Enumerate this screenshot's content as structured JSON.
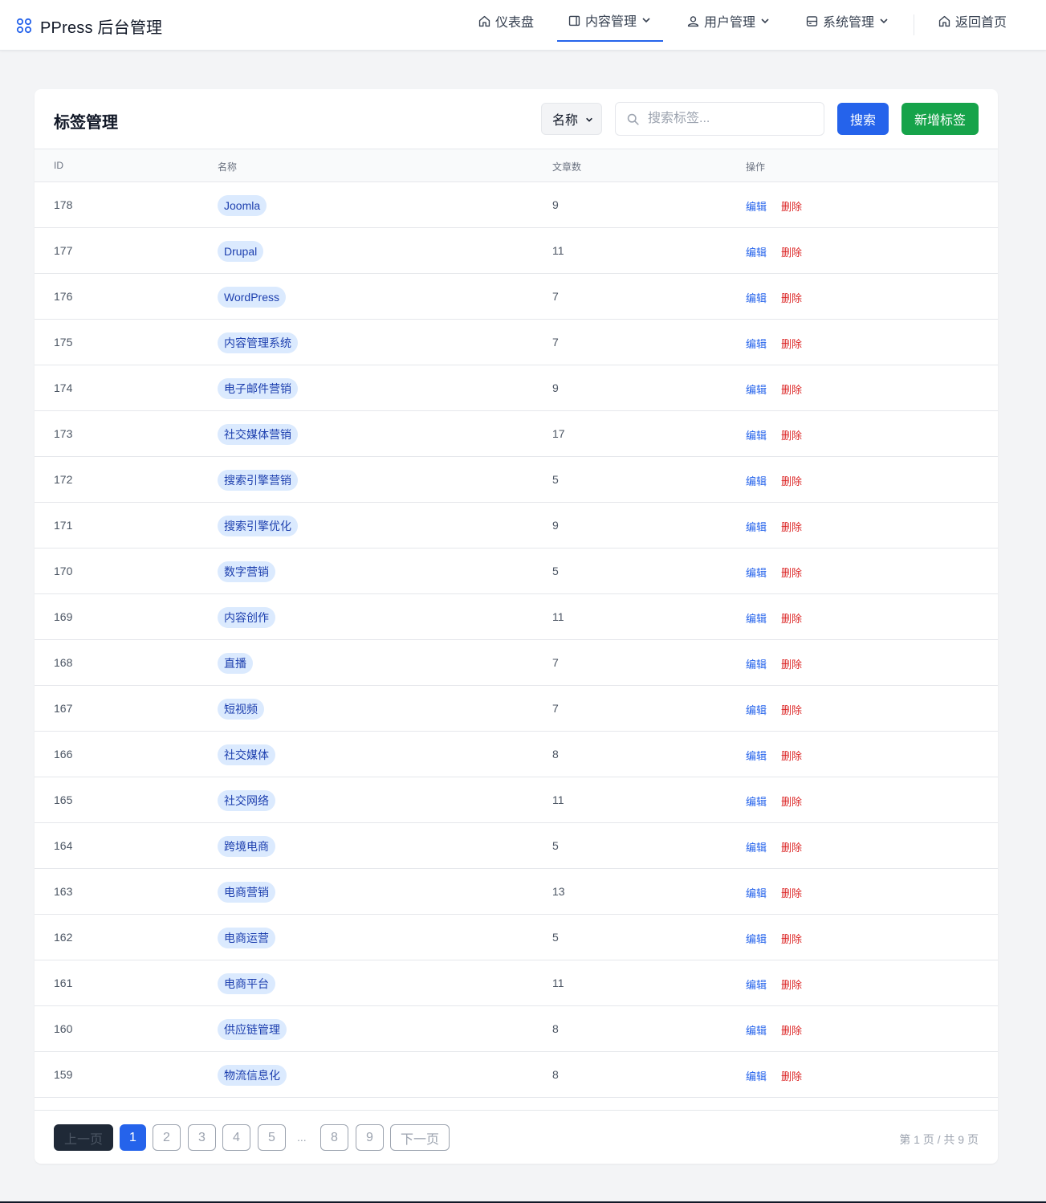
{
  "brand": {
    "title": "PPress 后台管理",
    "accent": "#2563eb"
  },
  "nav": [
    {
      "label": "仪表盘",
      "icon": "home-icon"
    },
    {
      "label": "内容管理",
      "icon": "document-icon",
      "active": true
    },
    {
      "label": "用户管理",
      "icon": "users-icon"
    },
    {
      "label": "系统管理",
      "icon": "server-icon"
    },
    {
      "label": "返回首页",
      "icon": "home-icon"
    }
  ],
  "page": {
    "title": "标签管理",
    "filter_selected": "名称",
    "search_placeholder": "搜索标签...",
    "search_label": "搜索",
    "add_label": "新增标签"
  },
  "table": {
    "columns": [
      "ID",
      "名称",
      "文章数",
      "操作"
    ],
    "edit_label": "编辑",
    "delete_label": "删除",
    "rows": [
      {
        "id": "178",
        "name": "Joomla",
        "count": "9"
      },
      {
        "id": "177",
        "name": "Drupal",
        "count": "11"
      },
      {
        "id": "176",
        "name": "WordPress",
        "count": "7"
      },
      {
        "id": "175",
        "name": "内容管理系统",
        "count": "7"
      },
      {
        "id": "174",
        "name": "电子邮件营销",
        "count": "9"
      },
      {
        "id": "173",
        "name": "社交媒体营销",
        "count": "17"
      },
      {
        "id": "172",
        "name": "搜索引擎营销",
        "count": "5"
      },
      {
        "id": "171",
        "name": "搜索引擎优化",
        "count": "9"
      },
      {
        "id": "170",
        "name": "数字营销",
        "count": "5"
      },
      {
        "id": "169",
        "name": "内容创作",
        "count": "11"
      },
      {
        "id": "168",
        "name": "直播",
        "count": "7"
      },
      {
        "id": "167",
        "name": "短视频",
        "count": "7"
      },
      {
        "id": "166",
        "name": "社交媒体",
        "count": "8"
      },
      {
        "id": "165",
        "name": "社交网络",
        "count": "11"
      },
      {
        "id": "164",
        "name": "跨境电商",
        "count": "5"
      },
      {
        "id": "163",
        "name": "电商营销",
        "count": "13"
      },
      {
        "id": "162",
        "name": "电商运营",
        "count": "5"
      },
      {
        "id": "161",
        "name": "电商平台",
        "count": "11"
      },
      {
        "id": "160",
        "name": "供应链管理",
        "count": "8"
      },
      {
        "id": "159",
        "name": "物流信息化",
        "count": "8"
      }
    ]
  },
  "pagination": {
    "prev_label": "上一页",
    "next_label": "下一页",
    "pages": [
      "1",
      "2",
      "3",
      "4",
      "5"
    ],
    "ellipsis": "...",
    "tail_pages": [
      "8",
      "9"
    ],
    "current": "1",
    "info": "第 1 页 / 共 9 页"
  }
}
